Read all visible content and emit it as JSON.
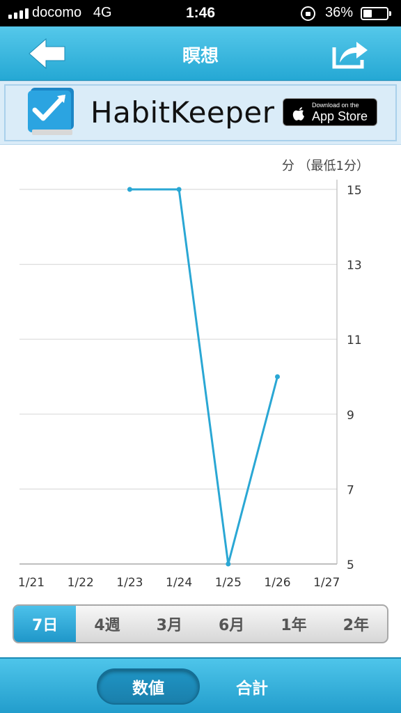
{
  "status_bar": {
    "carrier": "docomo",
    "network": "4G",
    "time": "1:46",
    "battery_percent": "36%",
    "battery_level": 0.36
  },
  "nav": {
    "title": "瞑想",
    "back_icon": "back-arrow-icon",
    "share_icon": "share-icon"
  },
  "banner": {
    "app_name": "HabitKeeper",
    "store_small": "Download on the",
    "store_big": "App Store",
    "colors": {
      "banner_bg": "#daecf8",
      "accent": "#2aa7d4"
    }
  },
  "chart_data": {
    "type": "line",
    "unit_label": "分 （最低1分）",
    "categories": [
      "1/21",
      "1/22",
      "1/23",
      "1/24",
      "1/25",
      "1/26",
      "1/27"
    ],
    "series": [
      {
        "values": [
          null,
          null,
          15,
          15,
          5,
          10,
          null
        ],
        "color": "#2aa7d4"
      }
    ],
    "y_ticks": [
      "15",
      "13",
      "11",
      "9",
      "7",
      "5"
    ],
    "ylim": [
      5,
      15
    ],
    "grid": true,
    "y_axis_side": "right"
  },
  "range_selector": {
    "options": [
      "7日",
      "4週",
      "3月",
      "6月",
      "1年",
      "2年"
    ],
    "selected": "7日"
  },
  "bottom_tabs": {
    "values_label": "数値",
    "total_label": "合計",
    "selected": "数値"
  }
}
